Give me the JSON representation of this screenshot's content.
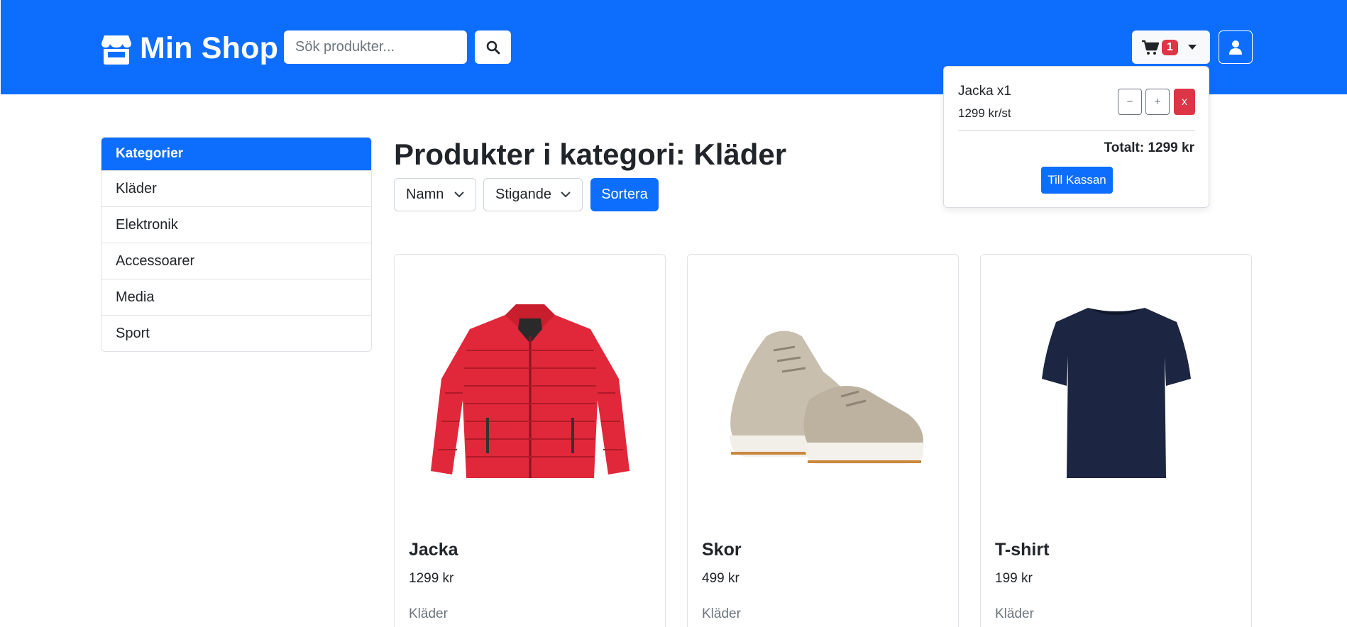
{
  "header": {
    "brand": "Min Shop",
    "search_placeholder": "Sök produkter...",
    "cart_count": "1"
  },
  "cart": {
    "items": [
      {
        "name": "Jacka x1",
        "price": "1299 kr/st",
        "minus": "−",
        "plus": "+",
        "remove": "x"
      }
    ],
    "total": "Totalt: 1299 kr",
    "checkout_label": "Till Kassan"
  },
  "sidebar": {
    "title": "Kategorier",
    "items": [
      "Kläder",
      "Elektronik",
      "Accessoarer",
      "Media",
      "Sport"
    ]
  },
  "main": {
    "title": "Produkter i kategori: Kläder",
    "sort_field": "Namn",
    "sort_direction": "Stigande",
    "sort_button": "Sortera"
  },
  "products": [
    {
      "name": "Jacka",
      "price": "1299 kr",
      "category": "Kläder",
      "image": "red-puffer-jacket"
    },
    {
      "name": "Skor",
      "price": "499 kr",
      "category": "Kläder",
      "image": "beige-sneakers"
    },
    {
      "name": "T-shirt",
      "price": "199 kr",
      "category": "Kläder",
      "image": "navy-tshirt"
    }
  ],
  "colors": {
    "primary": "#0d6efd",
    "danger": "#dc3545",
    "muted": "#6c757d"
  },
  "icons": {
    "brand": "shop-icon",
    "search": "search-icon",
    "cart": "cart-icon",
    "user": "user-icon"
  }
}
